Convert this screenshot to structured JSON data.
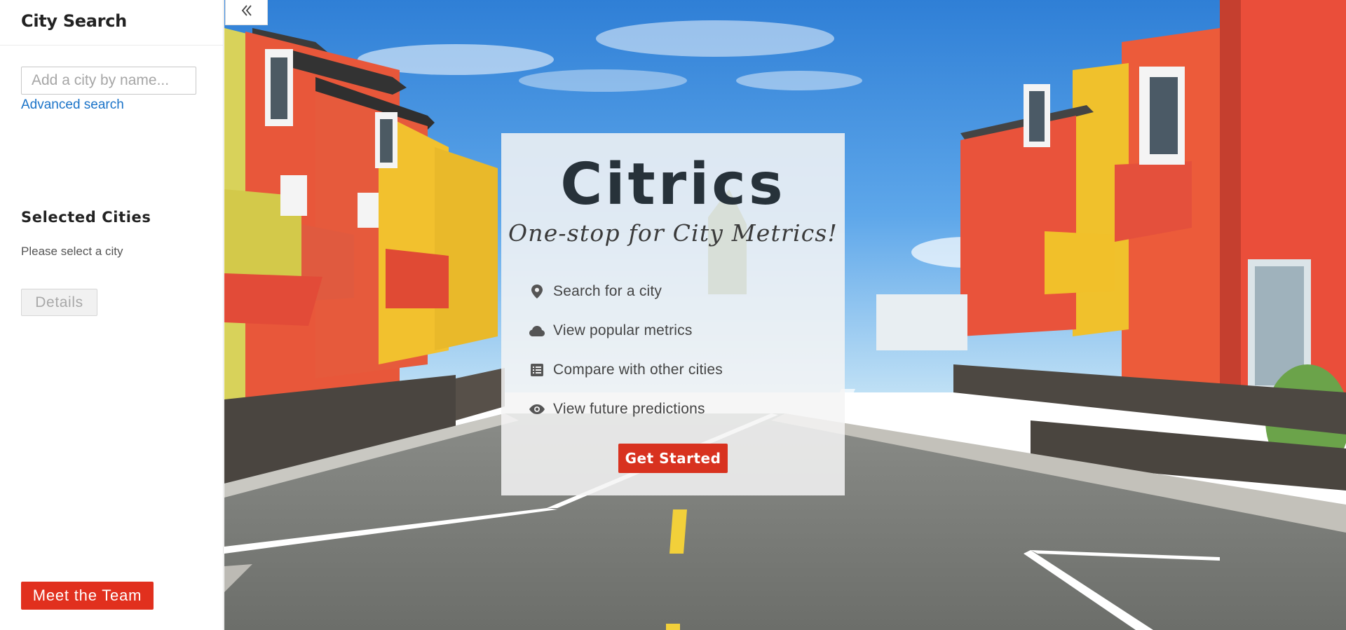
{
  "sidebar": {
    "title": "City Search",
    "search_placeholder": "Add a city by name...",
    "advanced_link": "Advanced search",
    "selected_title": "Selected Cities",
    "selected_empty": "Please select a city",
    "details_label": "Details",
    "team_label": "Meet the Team",
    "collapse_icon": "double-chevron-left-icon"
  },
  "hero": {
    "title": "Citrics",
    "subtitle": "One-stop for City Metrics!",
    "features": [
      {
        "icon": "map-pin-icon",
        "label": "Search for a city"
      },
      {
        "icon": "cloud-icon",
        "label": "View popular metrics"
      },
      {
        "icon": "list-icon",
        "label": "Compare with other cities"
      },
      {
        "icon": "eye-icon",
        "label": "View future predictions"
      }
    ],
    "cta_label": "Get Started"
  },
  "colors": {
    "accent_red": "#e1301e",
    "link_blue": "#1a73c8",
    "title_dark": "#27323a"
  }
}
